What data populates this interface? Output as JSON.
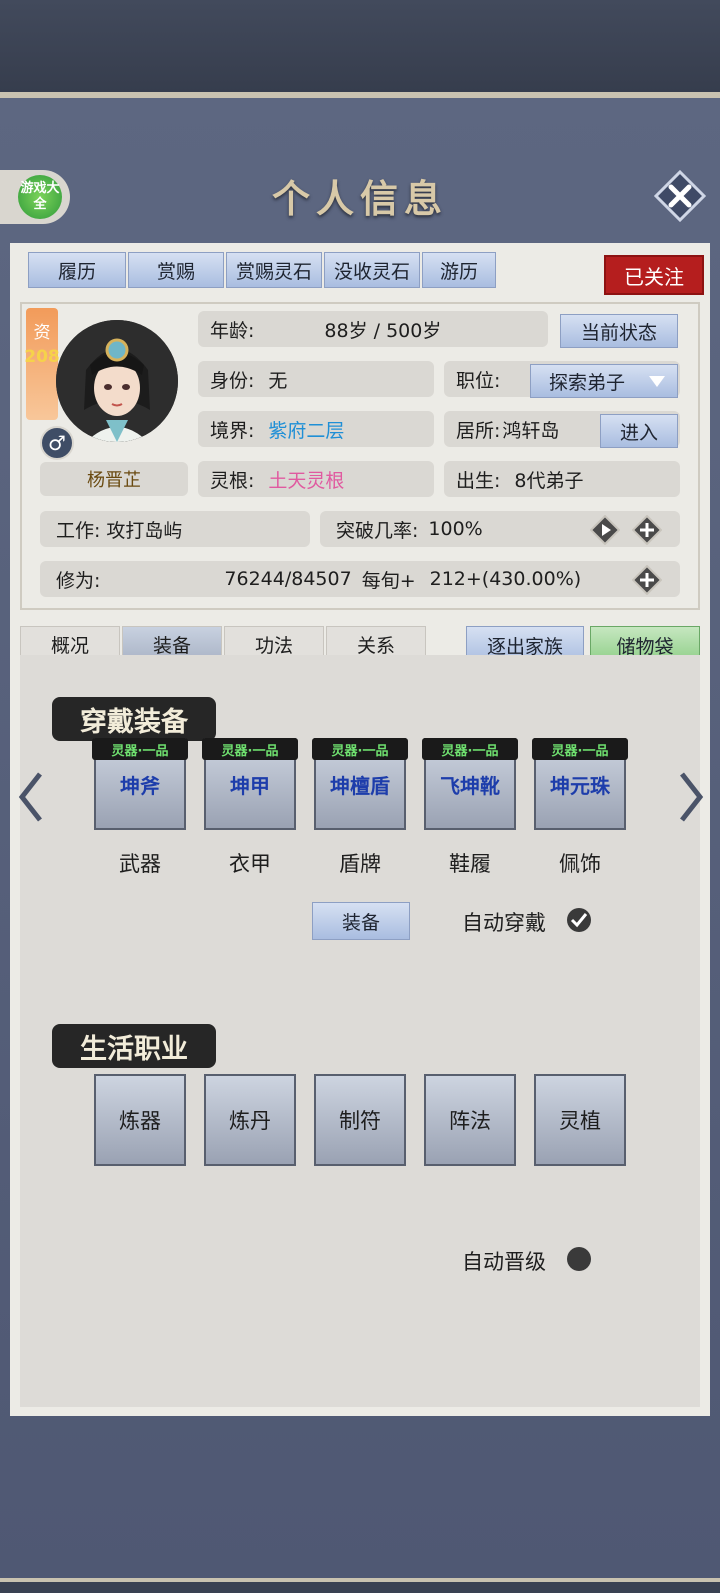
{
  "header": {
    "title": "个人信息",
    "badge_text": "游戏大全"
  },
  "top_tabs": [
    "履历",
    "赏赐",
    "赏赐灵石",
    "没收灵石",
    "游历"
  ],
  "follow_button": "已关注",
  "profile": {
    "resource_label": "资",
    "resource_value": "208",
    "name": "杨晋芷",
    "gender_icon": "♂"
  },
  "fields": {
    "age_label": "年龄:",
    "age_value": "88岁 / 500岁",
    "status_button": "当前状态",
    "identity_label": "身份:",
    "identity_value": "无",
    "position_label": "职位:",
    "position_value": "探索弟子",
    "realm_label": "境界:",
    "realm_value": "紫府二层",
    "residence_label": "居所:",
    "residence_value": "鸿轩岛",
    "enter_button": "进入",
    "root_label": "灵根:",
    "root_value": "土天灵根",
    "birth_label": "出生:",
    "birth_value": "8代弟子",
    "job_label": "工作:",
    "job_value": "攻打岛屿",
    "breakthrough_label": "突破几率:",
    "breakthrough_value": "100%",
    "cultivation_label": "修为:",
    "cultivation_value": "76244/84507",
    "per_turn_label": "每旬+",
    "per_turn_value": "212+(430.00%)"
  },
  "colors": {
    "realm": "#1f8fd6",
    "root": "#e05aa0",
    "red_button": "#b51e1e"
  },
  "sub_tabs": [
    "概况",
    "装备",
    "功法",
    "关系"
  ],
  "expel_button": "逐出家族",
  "storage_button": "储物袋",
  "equipment": {
    "section_title": "穿戴装备",
    "slots": [
      {
        "grade": "灵器·一品",
        "item": "坤斧",
        "slot": "武器"
      },
      {
        "grade": "灵器·一品",
        "item": "坤甲",
        "slot": "衣甲"
      },
      {
        "grade": "灵器·一品",
        "item": "坤檀盾",
        "slot": "盾牌"
      },
      {
        "grade": "灵器·一品",
        "item": "飞坤靴",
        "slot": "鞋履"
      },
      {
        "grade": "灵器·一品",
        "item": "坤元珠",
        "slot": "佩饰"
      }
    ],
    "equip_button": "装备",
    "auto_wear_label": "自动穿戴",
    "auto_wear_checked": true
  },
  "careers": {
    "section_title": "生活职业",
    "items": [
      "炼器",
      "炼丹",
      "制符",
      "阵法",
      "灵植"
    ],
    "auto_upgrade_label": "自动晋级",
    "auto_upgrade_checked": false
  }
}
